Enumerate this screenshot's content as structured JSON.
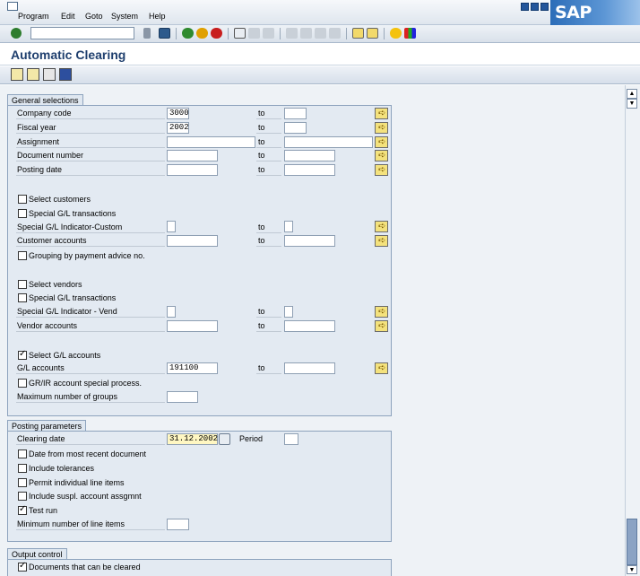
{
  "menu": [
    "Program",
    "Edit",
    "Goto",
    "System",
    "Help"
  ],
  "menu_underline": [
    "P",
    "E",
    "G",
    "S",
    "H"
  ],
  "brand": "SAP",
  "title": "Automatic Clearing",
  "groups": {
    "general": "General selections",
    "posting": "Posting parameters",
    "output": "Output control"
  },
  "general": {
    "company_code": {
      "label": "Company code",
      "from": "3000",
      "to": ""
    },
    "fiscal_year": {
      "label": "Fiscal year",
      "from": "2002",
      "to": ""
    },
    "assignment": {
      "label": "Assignment",
      "from": "",
      "to": ""
    },
    "document_number": {
      "label": "Document number",
      "from": "",
      "to": ""
    },
    "posting_date": {
      "label": "Posting date",
      "from": "",
      "to": ""
    },
    "to_label": "to",
    "select_customers": {
      "label": "Select customers",
      "checked": false
    },
    "special_gl_cust": {
      "label": "Special G/L transactions",
      "checked": false
    },
    "special_gl_ind_cust": {
      "label": "Special G/L Indicator-Custom",
      "from": "",
      "to": ""
    },
    "customer_accounts": {
      "label": "Customer accounts",
      "from": "",
      "to": ""
    },
    "grouping_payment": {
      "label": "Grouping by payment advice no.",
      "checked": false
    },
    "select_vendors": {
      "label": "Select vendors",
      "checked": false
    },
    "special_gl_vend": {
      "label": "Special G/L transactions",
      "checked": false
    },
    "special_gl_ind_vend": {
      "label": "Special G/L Indicator - Vend",
      "from": "",
      "to": ""
    },
    "vendor_accounts": {
      "label": "Vendor accounts",
      "from": "",
      "to": ""
    },
    "select_gl": {
      "label": "Select G/L accounts",
      "checked": true
    },
    "gl_accounts": {
      "label": "G/L accounts",
      "from": "191100",
      "to": ""
    },
    "grir_special": {
      "label": "GR/IR account special process.",
      "checked": false
    },
    "max_groups": {
      "label": "Maximum number of groups",
      "value": ""
    }
  },
  "posting": {
    "clearing_date": {
      "label": "Clearing date",
      "value": "31.12.2002"
    },
    "period": {
      "label": "Period",
      "value": ""
    },
    "date_recent": {
      "label": "Date from most recent document",
      "checked": false
    },
    "include_tolerances": {
      "label": "Include tolerances",
      "checked": false
    },
    "permit_individual": {
      "label": "Permit individual line items",
      "checked": false
    },
    "include_suspl": {
      "label": "Include suspl. account assgmnt",
      "checked": false
    },
    "test_run": {
      "label": "Test run",
      "checked": true
    },
    "min_line_items": {
      "label": "Minimum number of line items",
      "value": ""
    }
  },
  "output": {
    "docs_cleared": {
      "label": "Documents that can be cleared",
      "checked": true
    }
  },
  "check_mark": "✓",
  "arrow_glyph": "➪",
  "colors": {
    "arrow_bg": "#f4e27d",
    "title": "#1f3f6e",
    "group_bg": "#e3eaf2"
  }
}
